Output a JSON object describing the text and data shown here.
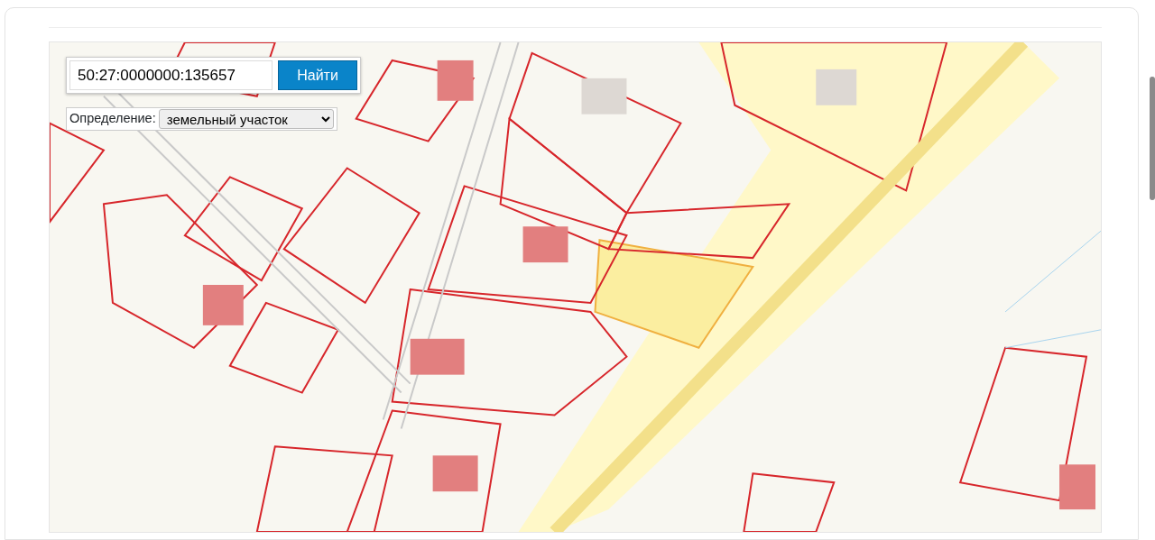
{
  "search": {
    "value": "50:27:0000000:135657",
    "button": "Найти"
  },
  "filter": {
    "label": "Определение:",
    "value": "земельный участок"
  }
}
